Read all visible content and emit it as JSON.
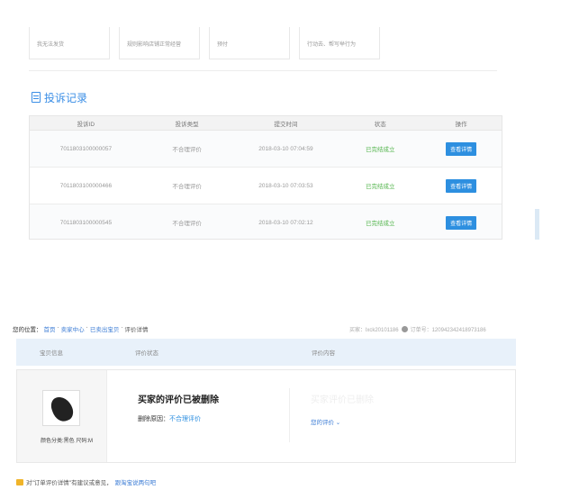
{
  "top_tabs": [
    "我无法发货",
    "规则影响店铺正常经营",
    "预付",
    "行动去、帮写举行为"
  ],
  "section_title": "投诉记录",
  "complaint_table": {
    "headers": [
      "投诉ID",
      "投诉类型",
      "提交时间",
      "状态",
      "操作"
    ],
    "rows": [
      {
        "id": "7011803100000057",
        "type": "不合理评价",
        "time": "2018-03-10 07:04:59",
        "status": "已完结成立",
        "action": "查看详情"
      },
      {
        "id": "7011803100000466",
        "type": "不合理评价",
        "time": "2018-03-10 07:03:53",
        "status": "已完结成立",
        "action": "查看详情"
      },
      {
        "id": "7011803100000545",
        "type": "不合理评价",
        "time": "2018-03-10 07:02:12",
        "status": "已完结成立",
        "action": "查看详情"
      }
    ]
  },
  "breadcrumb": {
    "prefix": "您的位置：",
    "items": [
      "首页",
      "卖家中心",
      "已卖出宝贝"
    ],
    "current": "评价详情",
    "sep": "·"
  },
  "buyer_info": {
    "buyer": "买家：lxck20101186",
    "order": "订单号：120942342418973186"
  },
  "review_table": {
    "headers": [
      "宝贝信息",
      "评价状态",
      "评价内容"
    ]
  },
  "review": {
    "product_spec": "颜色分类:黑色  尺码:M",
    "deleted_title": "买家的评价已被删除",
    "reason_label": "删除原因：",
    "reason_value": "不合理评价",
    "ghost_title": "买家评价已删除",
    "your_review": "您的评价 ⌄"
  },
  "feedback": {
    "text": "对\"订单评价详情\"有建议或意见，",
    "link": "跟淘宝说两句吧"
  },
  "colors": {
    "accent": "#2d8fe0",
    "success": "#52b44b",
    "header_bg": "#e8f1fa"
  }
}
